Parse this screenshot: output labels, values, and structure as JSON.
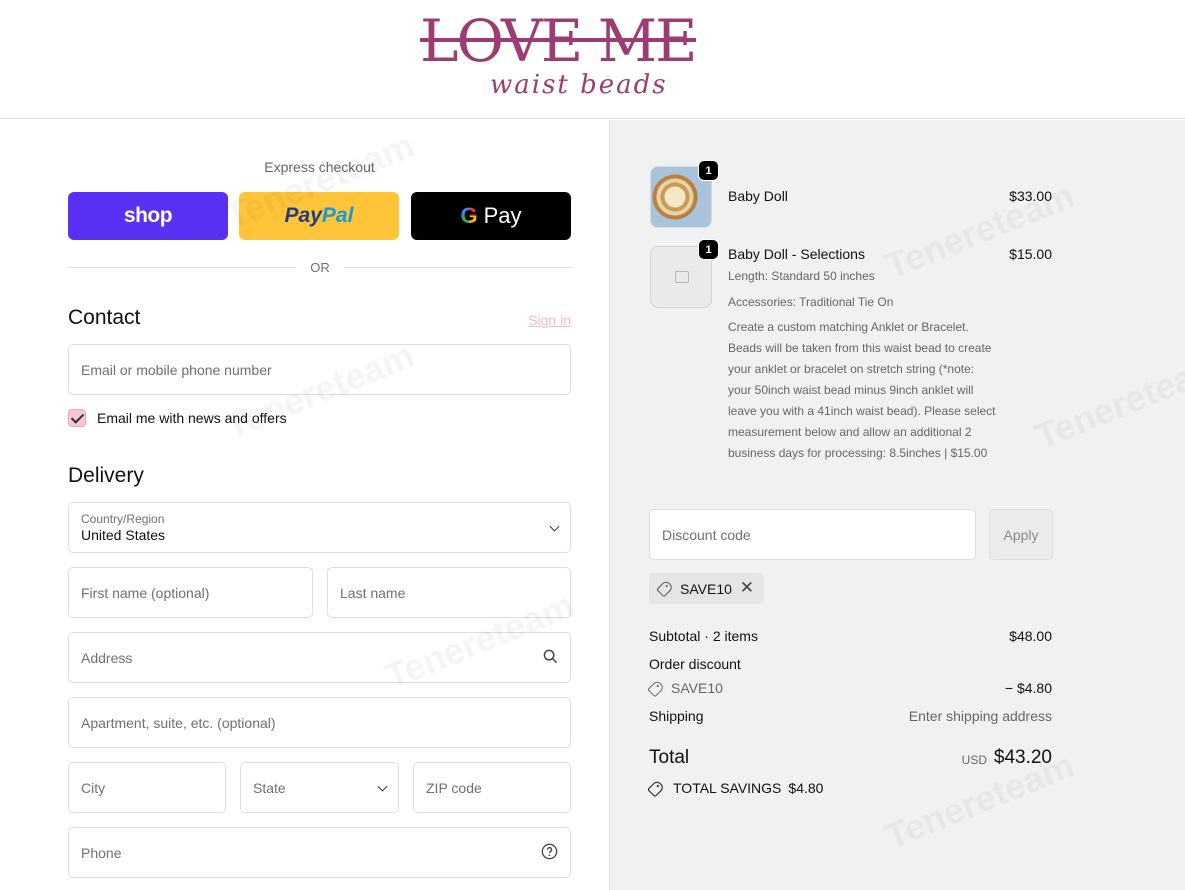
{
  "header": {
    "logo_main": "LOVE ME",
    "logo_sub": "waist beads"
  },
  "express": {
    "title": "Express checkout",
    "shop_label": "shop",
    "paypal_label_1": "Pay",
    "paypal_label_2": "Pal",
    "gpay_g": "G",
    "gpay_label": "Pay",
    "or_label": "OR"
  },
  "contact": {
    "title": "Contact",
    "sign_in": "Sign in",
    "email_placeholder": "Email or mobile phone number",
    "newsletter_label": "Email me with news and offers",
    "newsletter_checked": true
  },
  "delivery": {
    "title": "Delivery",
    "country_label": "Country/Region",
    "country_value": "United States",
    "first_name_placeholder": "First name (optional)",
    "last_name_placeholder": "Last name",
    "address_placeholder": "Address",
    "apartment_placeholder": "Apartment, suite, etc. (optional)",
    "city_placeholder": "City",
    "state_placeholder": "State",
    "zip_placeholder": "ZIP code",
    "phone_placeholder": "Phone"
  },
  "order": {
    "items": [
      {
        "name": "Baby Doll",
        "price": "$33.00",
        "quantity": "1"
      },
      {
        "name": "Baby Doll - Selections",
        "price": "$15.00",
        "quantity": "1",
        "length": "Length: Standard 50 inches",
        "accessories": "Accessories: Traditional Tie On",
        "description": "Create a custom matching Anklet or Bracelet. Beads will be taken from this waist bead to create your anklet or bracelet on stretch string (*note: your 50inch waist bead minus 9inch anklet will leave you with a 41inch waist bead). Please select measurement below and allow an additional 2 business days for processing: 8.5inches | $15.00"
      }
    ],
    "discount_placeholder": "Discount code",
    "apply_label": "Apply",
    "applied_code": "SAVE10",
    "subtotal_label": "Subtotal · 2 items",
    "subtotal_value": "$48.00",
    "order_discount_label": "Order discount",
    "discount_code_label": "SAVE10",
    "discount_value": "− $4.80",
    "shipping_label": "Shipping",
    "shipping_value": "Enter shipping address",
    "total_label": "Total",
    "total_currency": "USD",
    "total_value": "$43.20",
    "savings_label": "TOTAL SAVINGS",
    "savings_value": "$4.80"
  },
  "watermark": "Tenereteam"
}
